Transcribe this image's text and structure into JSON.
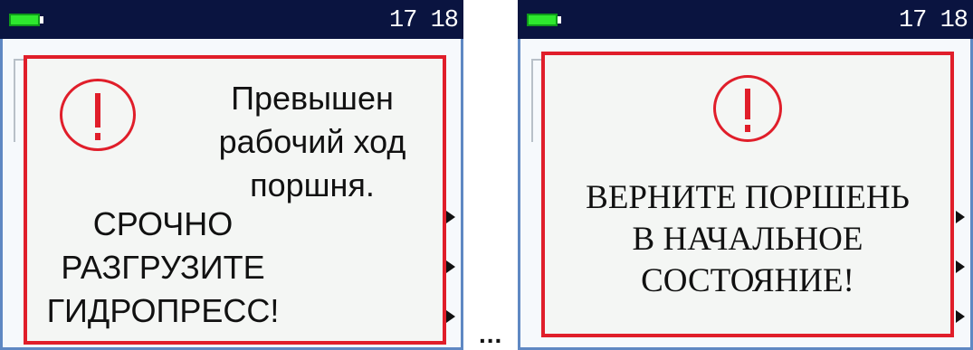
{
  "colors": {
    "status_bar": "#0a1440",
    "battery": "#2ee82e",
    "alert_red": "#e01e2a",
    "frame_blue": "#5f88c3"
  },
  "screens": [
    {
      "time": "17 18",
      "icon": "exclamation-circle-icon",
      "message_top": [
        "Превышен",
        "рабочий ход",
        "поршня."
      ],
      "message_bottom": [
        "СРОЧНО",
        "РАЗГРУЗИТЕ",
        "ГИДРОПРЕСС!"
      ]
    },
    {
      "time": "17 18",
      "icon": "exclamation-circle-icon",
      "message": [
        "ВЕРНИТЕ ПОРШЕНЬ",
        "В НАЧАЛЬНОЕ",
        "СОСТОЯНИЕ!"
      ]
    }
  ],
  "separator": "..."
}
